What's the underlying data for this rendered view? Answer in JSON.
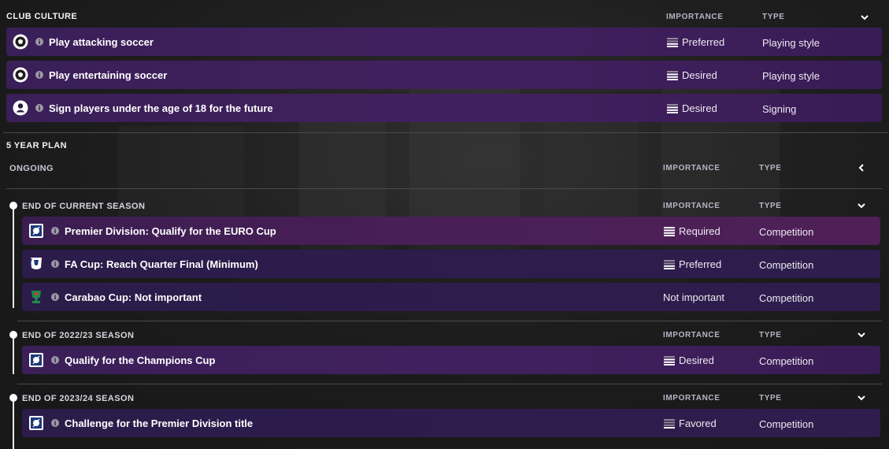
{
  "club_culture": {
    "title": "CLUB CULTURE",
    "importance_header": "IMPORTANCE",
    "type_header": "TYPE",
    "rows": [
      {
        "icon": "soccer-ball-icon",
        "label": "Play attacking soccer",
        "importance": "Preferred",
        "type": "Playing style"
      },
      {
        "icon": "soccer-ball-icon",
        "label": "Play entertaining soccer",
        "importance": "Desired",
        "type": "Playing style"
      },
      {
        "icon": "person-icon",
        "label": "Sign players under the age of 18 for the future",
        "importance": "Desired",
        "type": "Signing"
      }
    ]
  },
  "five_year_plan": {
    "title": "5 YEAR PLAN",
    "ongoing": {
      "label": "ONGOING",
      "importance_header": "IMPORTANCE",
      "type_header": "TYPE"
    },
    "groups": [
      {
        "title": "END OF CURRENT SEASON",
        "importance_header": "IMPORTANCE",
        "type_header": "TYPE",
        "rows": [
          {
            "icon": "premier-division-badge-icon",
            "label": "Premier Division: Qualify for the EURO Cup",
            "importance": "Required",
            "type": "Competition"
          },
          {
            "icon": "fa-cup-badge-icon",
            "label": "FA Cup: Reach Quarter Final (Minimum)",
            "importance": "Preferred",
            "type": "Competition"
          },
          {
            "icon": "carabao-cup-badge-icon",
            "label": "Carabao Cup: Not important",
            "importance": "Not important",
            "type": "Competition"
          }
        ]
      },
      {
        "title": "END OF 2022/23 SEASON",
        "importance_header": "IMPORTANCE",
        "type_header": "TYPE",
        "rows": [
          {
            "icon": "premier-division-badge-icon",
            "label": "Qualify for the Champions Cup",
            "importance": "Desired",
            "type": "Competition"
          }
        ]
      },
      {
        "title": "END OF 2023/24 SEASON",
        "importance_header": "IMPORTANCE",
        "type_header": "TYPE",
        "rows": [
          {
            "icon": "premier-division-badge-icon",
            "label": "Challenge for the Premier Division title",
            "importance": "Favored",
            "type": "Competition"
          }
        ]
      }
    ]
  },
  "colors": {
    "row_violet": "#3f205d",
    "row_dark": "#2d1d4b",
    "row_magenta": "#4a1f57",
    "accent_white": "#ffffff",
    "timeline": "#e9e9e9"
  }
}
